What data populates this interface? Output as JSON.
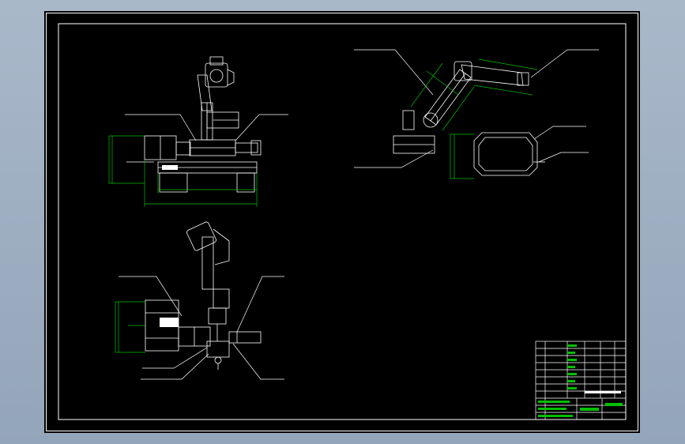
{
  "app": {
    "title": ""
  },
  "drawing": {
    "background_color": "#000000",
    "line_color": "#ffffff",
    "dimension_color": "#00c000",
    "frame_color": "#ffffff"
  },
  "views": [
    {
      "id": "front-view"
    },
    {
      "id": "top-view"
    },
    {
      "id": "isometric-view"
    }
  ],
  "title_block": {
    "rows": 11,
    "label_color": "#00c000"
  }
}
